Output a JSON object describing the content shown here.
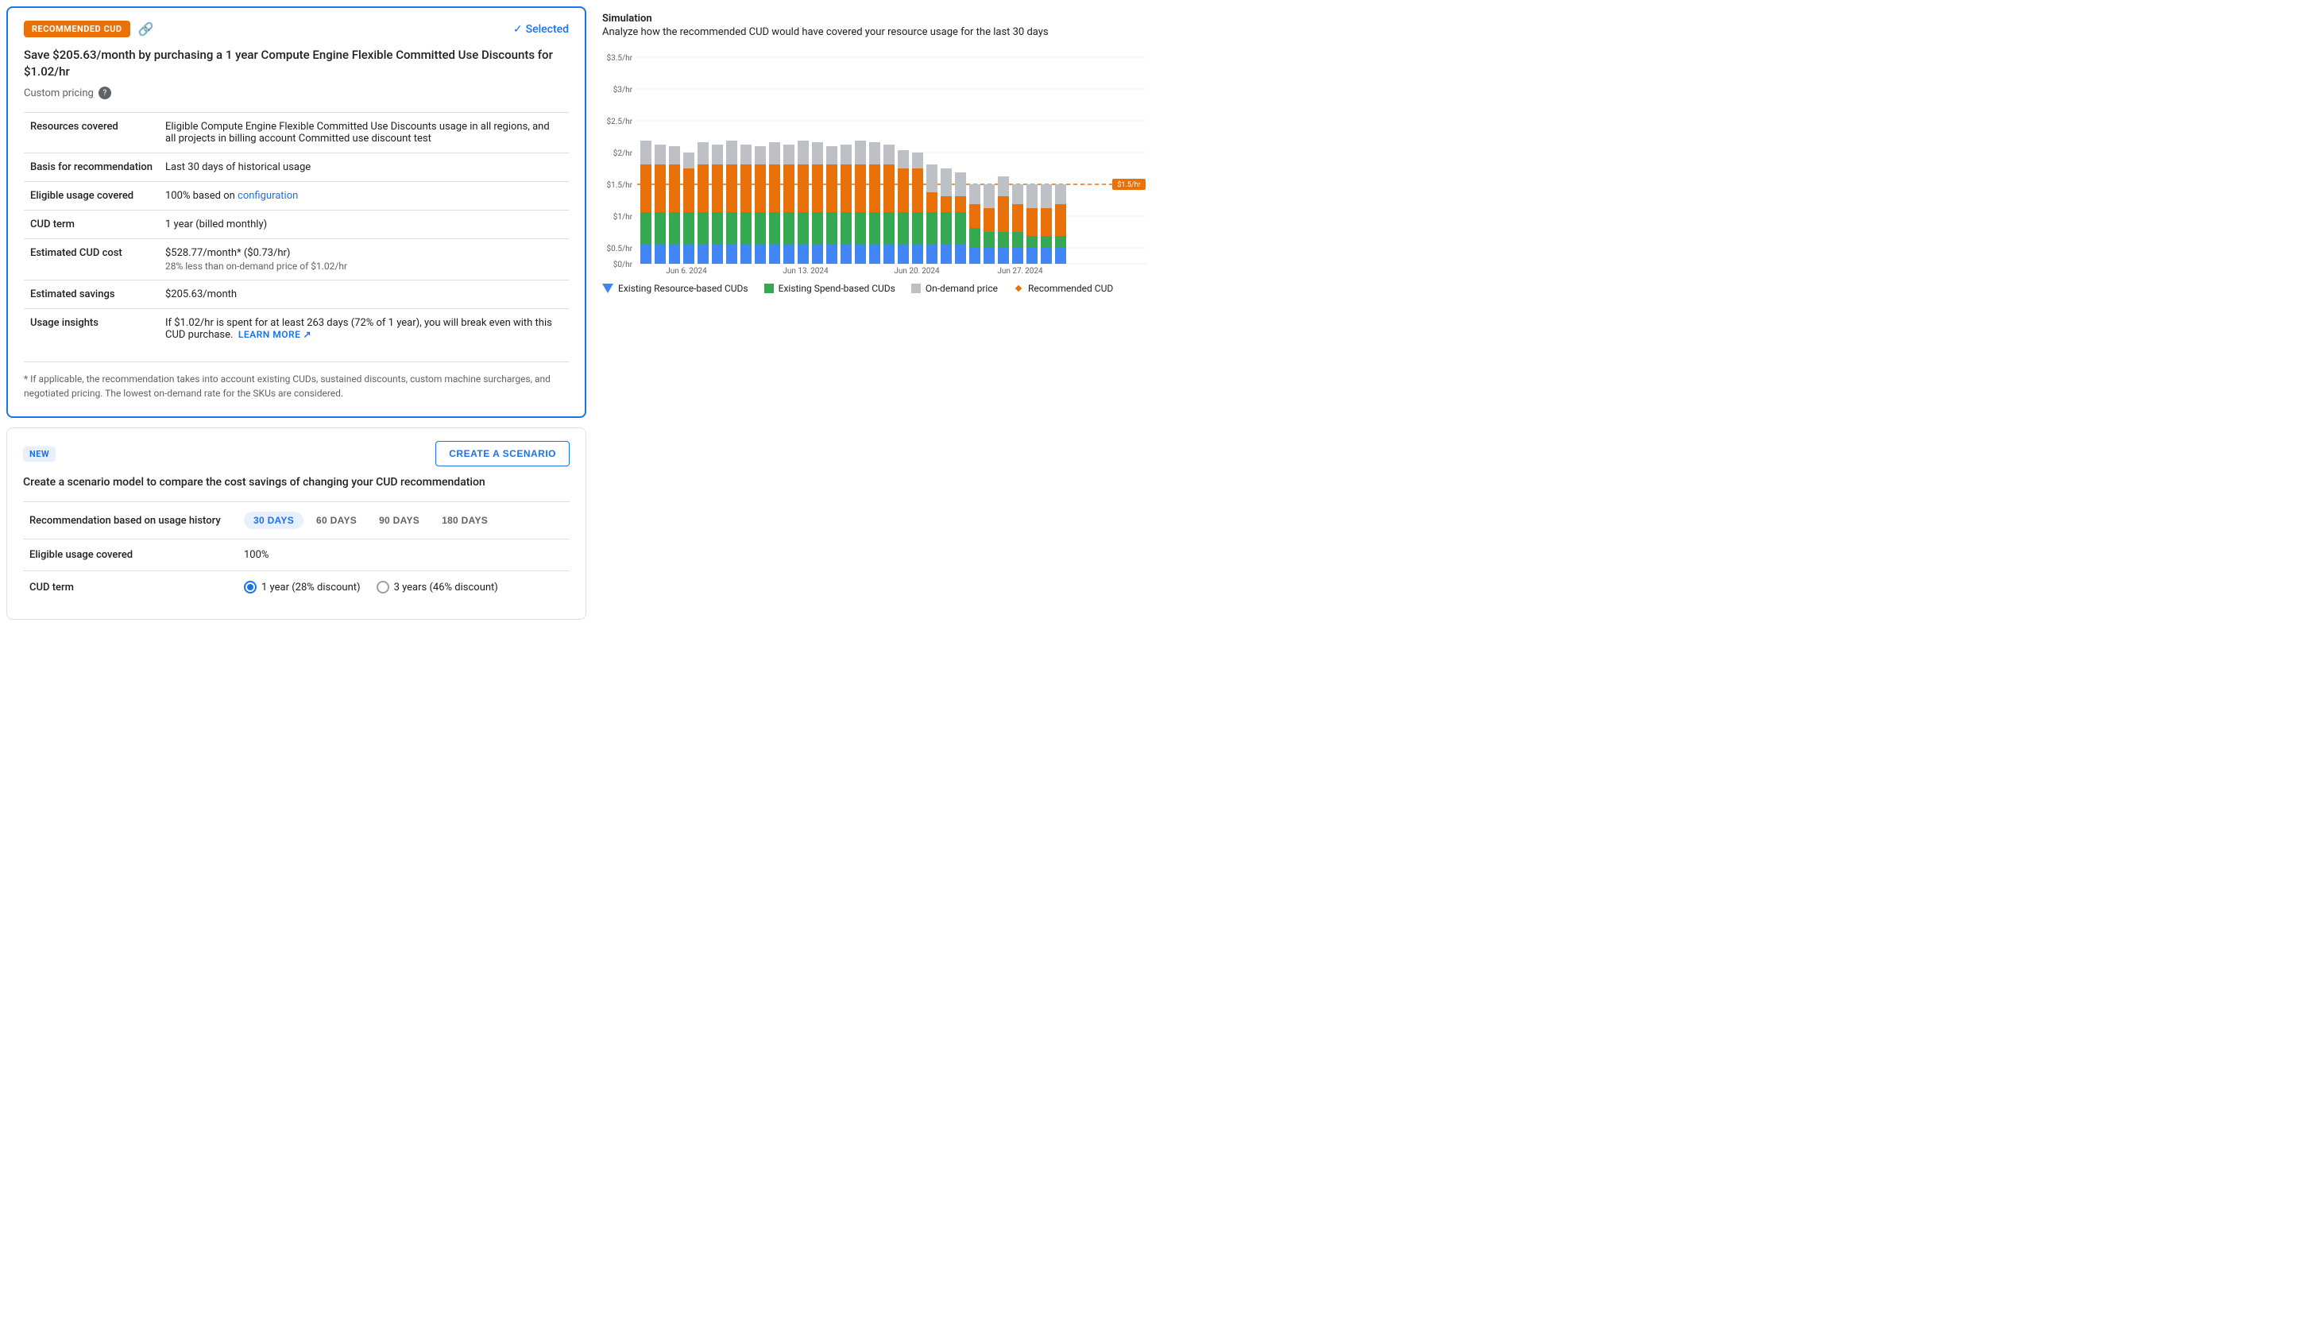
{
  "recommended_badge": "RECOMMENDED CUD",
  "selected_label": "Selected",
  "save_title": "Save $205.63/month by purchasing a 1 year Compute Engine Flexible Committed Use Discounts for $1.02/hr",
  "custom_pricing_label": "Custom pricing",
  "details": {
    "resources_covered_label": "Resources covered",
    "resources_covered_value": "Eligible Compute Engine Flexible Committed Use Discounts usage in all regions, and all projects in billing account Committed use discount test",
    "basis_label": "Basis for recommendation",
    "basis_value": "Last 30 days of historical usage",
    "eligible_label": "Eligible usage covered",
    "eligible_value": "100% based on ",
    "eligible_link": "configuration",
    "cud_term_label": "CUD term",
    "cud_term_value": "1 year (billed monthly)",
    "estimated_cost_label": "Estimated CUD cost",
    "estimated_cost_value": "$528.77/month* ($0.73/hr)",
    "estimated_cost_secondary": "28% less than on-demand price of $1.02/hr",
    "estimated_savings_label": "Estimated savings",
    "estimated_savings_value": "$205.63/month",
    "usage_insights_label": "Usage insights",
    "usage_insights_value": "If $1.02/hr is spent for at least 263 days (72% of 1 year), you will break even with this CUD purchase.",
    "learn_more_label": "LEARN MORE"
  },
  "footnote": "* If applicable, the recommendation takes into account existing CUDs, sustained discounts, custom machine surcharges, and negotiated pricing. The lowest on-demand rate for the SKUs are considered.",
  "scenario": {
    "new_badge": "NEW",
    "create_btn": "CREATE A SCENARIO",
    "title": "Create a scenario model to compare the cost savings of changing your CUD recommendation",
    "rec_label": "Recommendation based on usage history",
    "days_options": [
      "30 DAYS",
      "60 DAYS",
      "90 DAYS",
      "180 DAYS"
    ],
    "days_active": "30 DAYS",
    "eligible_label": "Eligible usage covered",
    "eligible_value": "100%",
    "cud_term_label": "CUD term",
    "radio_options": [
      {
        "label": "1 year (28% discount)",
        "selected": true
      },
      {
        "label": "3 years (46% discount)",
        "selected": false
      }
    ]
  },
  "simulation": {
    "title": "Simulation",
    "subtitle": "Analyze how the recommended CUD would have covered your resource usage for the last 30 days",
    "y_labels": [
      "$3.5/hr",
      "$3/hr",
      "$2.5/hr",
      "$2/hr",
      "$1.5/hr",
      "$1/hr",
      "$0.5/hr",
      "$0/hr"
    ],
    "x_labels": [
      "Jun 6, 2024",
      "Jun 13, 2024",
      "Jun 20, 2024",
      "Jun 27, 2024"
    ],
    "recommended_cud_label": "$1.5/hr",
    "legend": [
      {
        "label": "Existing Resource-based CUDs",
        "color": "#4285f4",
        "type": "triangle"
      },
      {
        "label": "Existing Spend-based CUDs",
        "color": "#34a853",
        "type": "square"
      },
      {
        "label": "On-demand price",
        "color": "#bdc1c6",
        "type": "square"
      },
      {
        "label": "Recommended CUD",
        "color": "#e8710a",
        "type": "diamond"
      }
    ]
  }
}
